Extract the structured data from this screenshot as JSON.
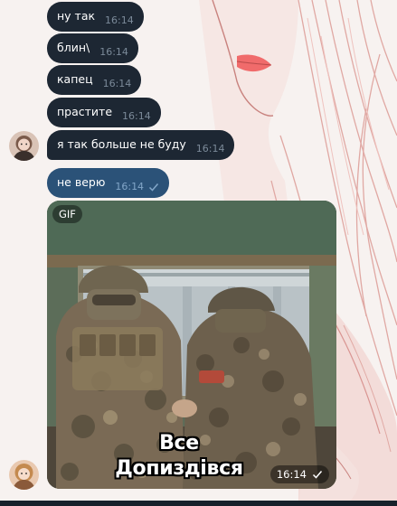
{
  "colors": {
    "incoming_bubble": "#1d2733",
    "outgoing_bubble": "#2b5278",
    "time_incoming": "#7b8a99",
    "time_outgoing": "#82a6c8"
  },
  "messages": [
    {
      "text": "ну так",
      "time": "16:14",
      "direction": "in"
    },
    {
      "text": "блин\\",
      "time": "16:14",
      "direction": "in"
    },
    {
      "text": "капец",
      "time": "16:14",
      "direction": "in"
    },
    {
      "text": "прастите",
      "time": "16:14",
      "direction": "in"
    },
    {
      "text": "я так больше не буду",
      "time": "16:14",
      "direction": "in"
    },
    {
      "text": "не верю",
      "time": "16:14",
      "direction": "out",
      "status": "sent-check-icon"
    }
  ],
  "gif": {
    "badge": "GIF",
    "caption_line1": "Все",
    "caption_line2": "Допиздівся",
    "time": "16:14",
    "status": "sent-check-icon"
  },
  "icons": {
    "sent": "check-icon",
    "avatar": "user-avatar"
  }
}
